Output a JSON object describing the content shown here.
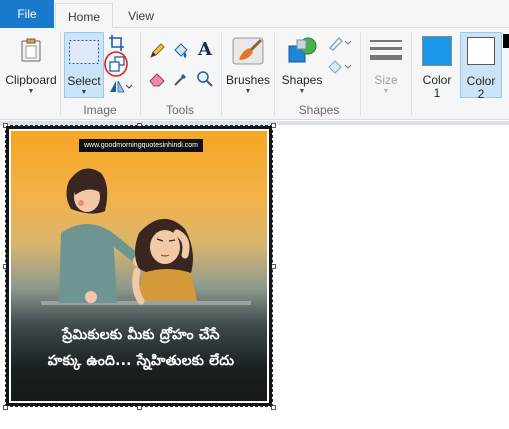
{
  "tabs": {
    "file": "File",
    "home": "Home",
    "view": "View"
  },
  "ribbon": {
    "clipboard": {
      "label": "Clipboard"
    },
    "image": {
      "select_label": "Select",
      "group_label": "Image"
    },
    "tools": {
      "group_label": "Tools",
      "text_glyph": "A"
    },
    "brushes": {
      "label": "Brushes"
    },
    "shapes": {
      "label": "Shapes",
      "group_label": "Shapes"
    },
    "size": {
      "label": "Size"
    },
    "color1": {
      "label": "Color",
      "sub": "1",
      "value": "#1a96e8"
    },
    "color2": {
      "label": "Color",
      "sub": "2",
      "value": "#ffffff"
    }
  },
  "canvas": {
    "watermark": "www.goodmorningquotesinhindi.com",
    "quote_line1": "ప్రేమికులకు మీకు ద్రోహం చేసే",
    "quote_line2": "హక్కు ఉంది... స్నేహితులకు లేదు"
  },
  "colors": {
    "accent": "#1979ca",
    "annotation_circle": "#e0201f",
    "selected_group_bg": "#cce4f7"
  }
}
